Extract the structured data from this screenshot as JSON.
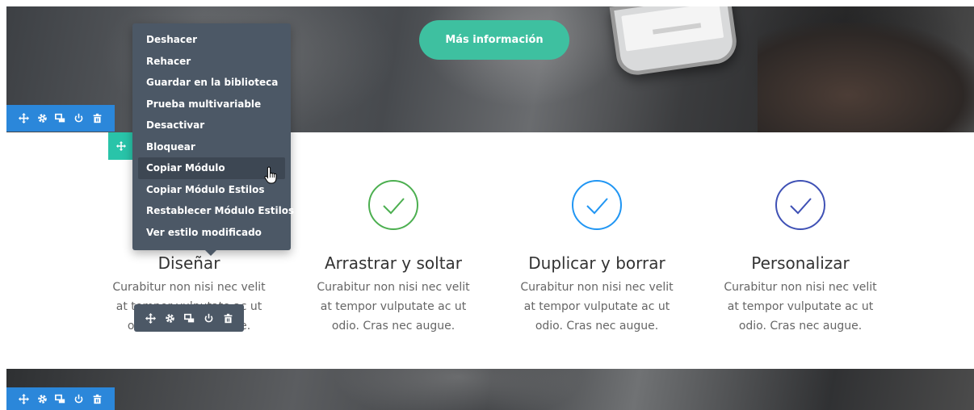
{
  "hero": {
    "cta_label": "Más información"
  },
  "context_menu": {
    "items": [
      "Deshacer",
      "Rehacer",
      "Guardar en la biblioteca",
      "Prueba multivariable",
      "Desactivar",
      "Bloquear",
      "Copiar Módulo",
      "Copiar Módulo Estilos",
      "Restablecer Módulo Estilos",
      "Ver estilo modificado"
    ],
    "active_item": "Copiar Módulo"
  },
  "toolbar_icons": [
    "move-icon",
    "settings-icon",
    "duplicate-icon",
    "disable-icon",
    "delete-icon"
  ],
  "features": [
    {
      "title": "Diseñar",
      "text": "Curabitur non nisi nec velit at tempor vulputate ac ut odio. Cras nec augue.",
      "color": "#4caf50"
    },
    {
      "title": "Arrastrar y soltar",
      "text": "Curabitur non nisi nec velit at tempor vulputate ac ut odio. Cras nec augue.",
      "color": "#4caf50"
    },
    {
      "title": "Duplicar y borrar",
      "text": "Curabitur non nisi nec velit at tempor vulputate ac ut odio. Cras nec augue.",
      "color": "#2196f3"
    },
    {
      "title": "Personalizar",
      "text": "Curabitur non nisi nec velit at tempor vulputate ac ut odio. Cras nec augue.",
      "color": "#3f51b5"
    }
  ],
  "colors": {
    "row_toolbar": "#2b87da",
    "module_toolbar": "#4c5866",
    "column_handle": "#29c4a9",
    "cta": "#3ec0a0"
  }
}
